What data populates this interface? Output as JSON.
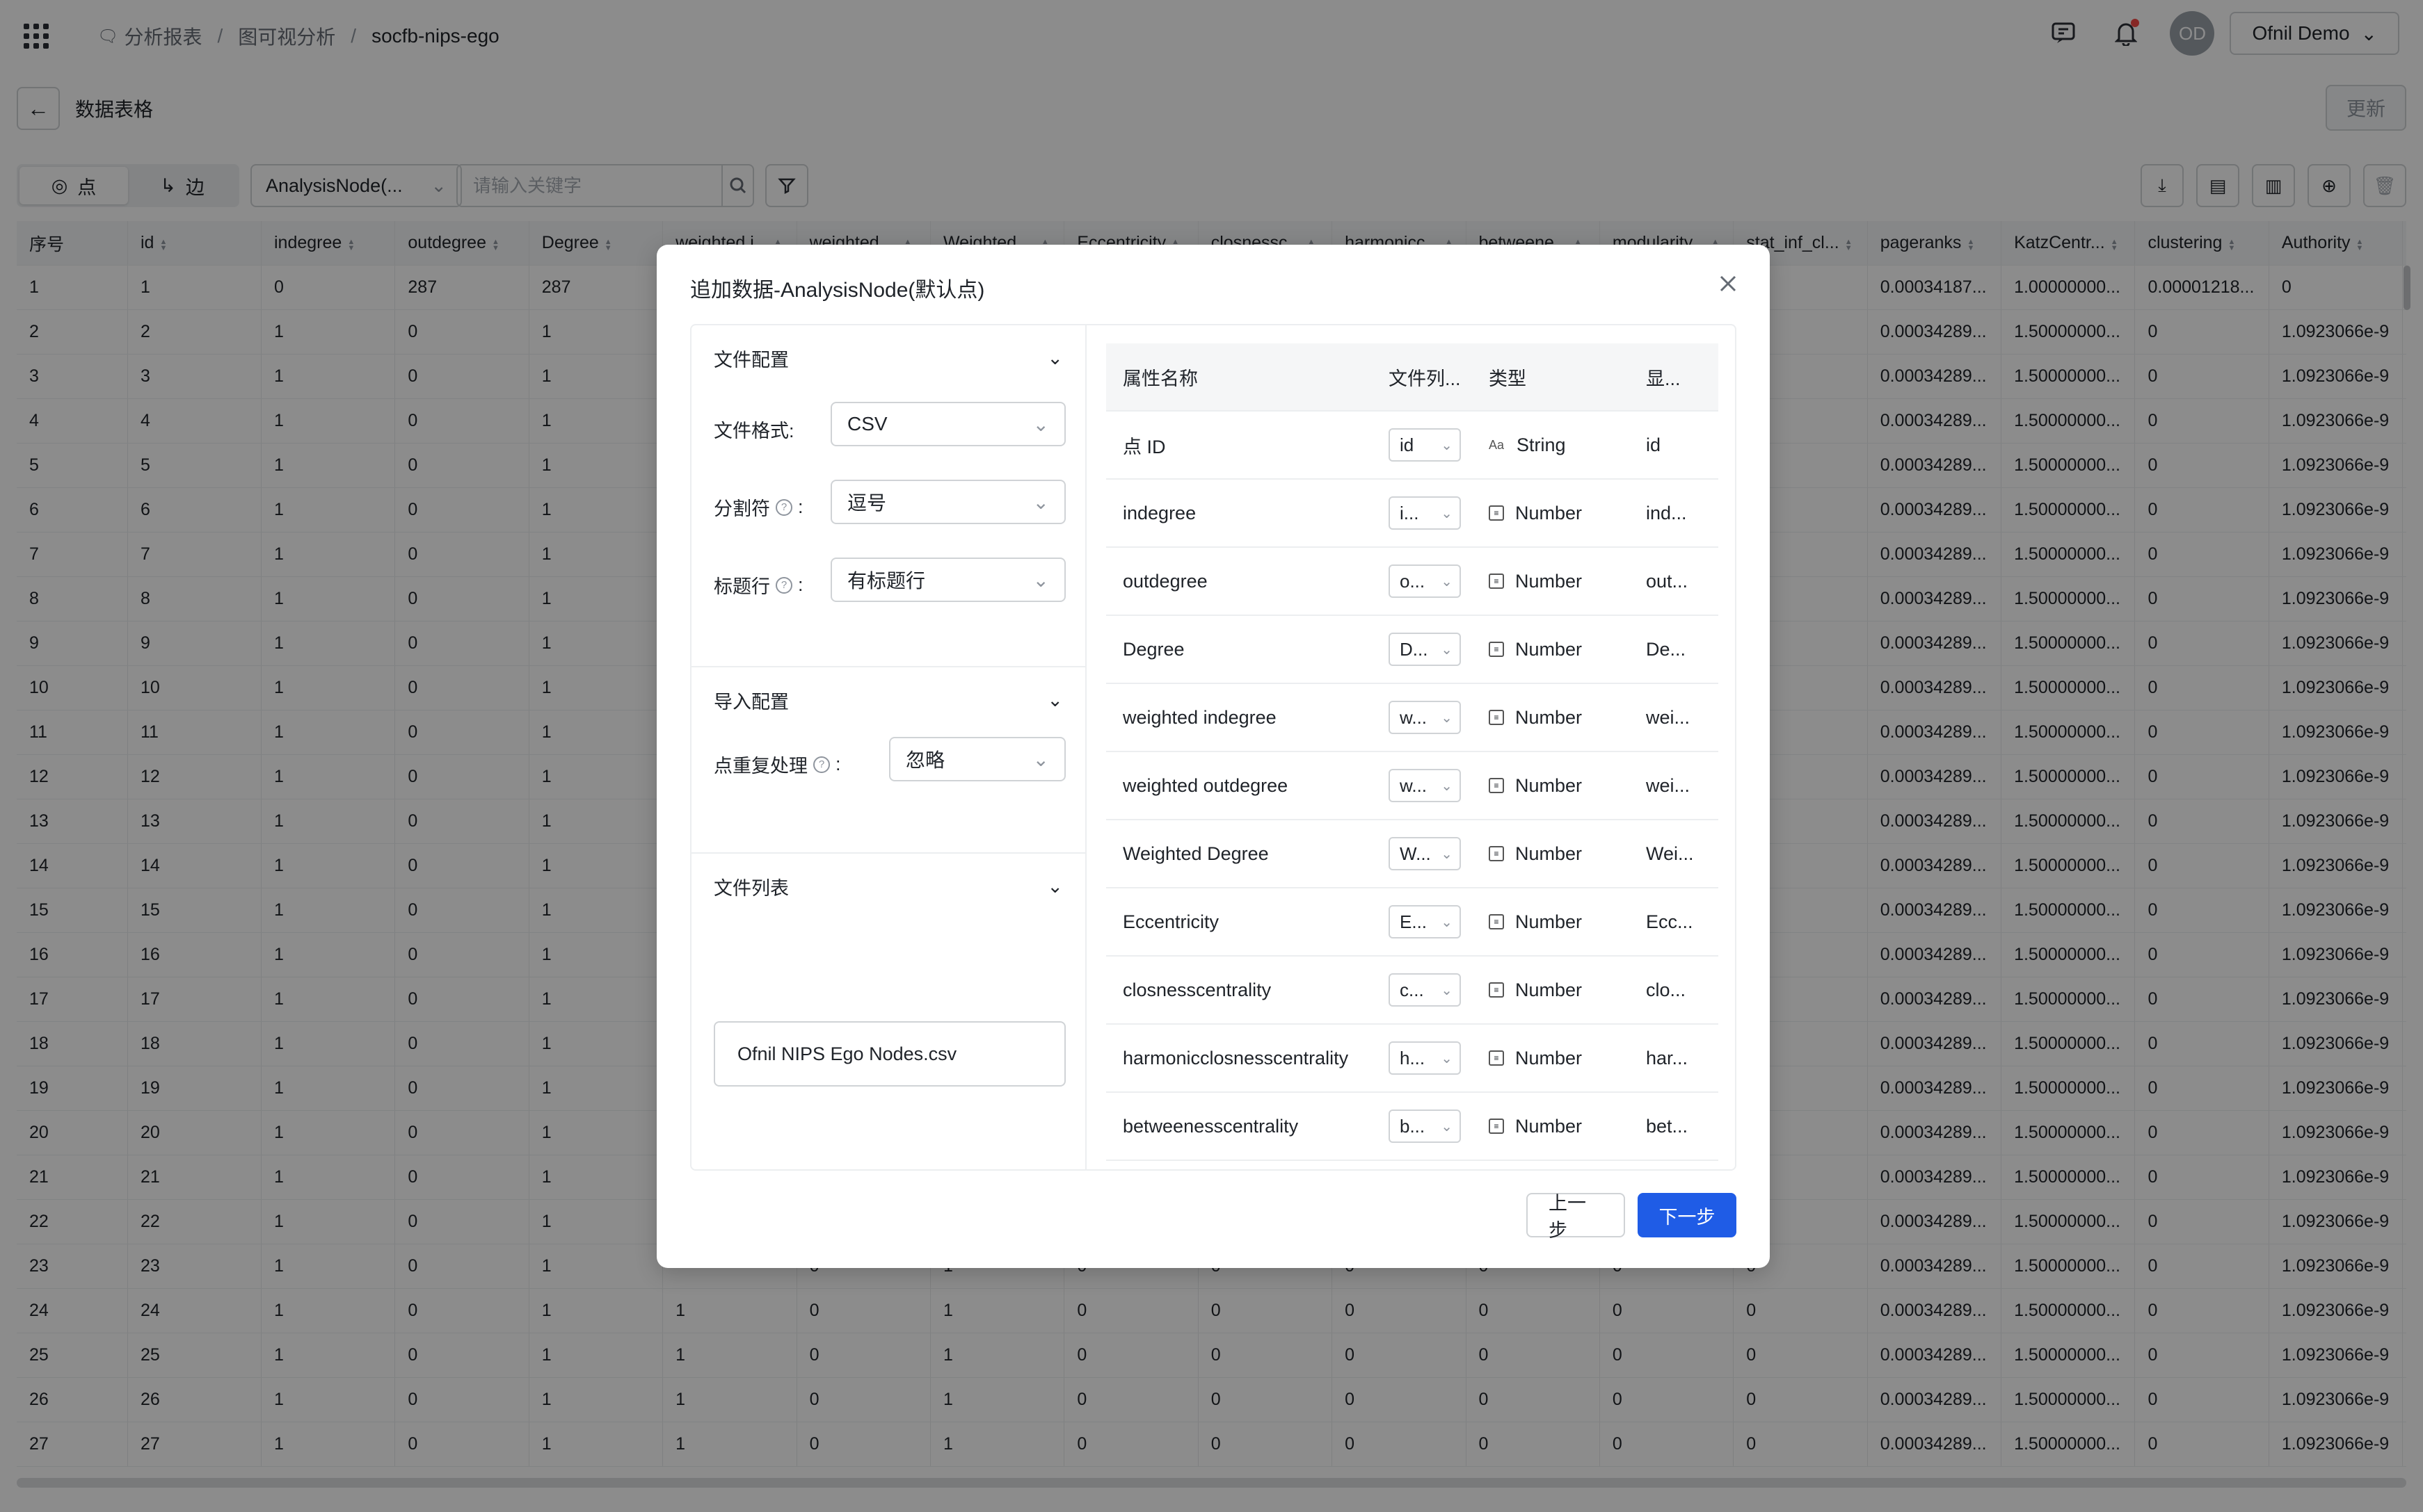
{
  "header": {
    "breadcrumb": [
      "分析报表",
      "图可视分析",
      "socfb-nips-ego"
    ],
    "user_initials": "OD",
    "user_name": "Ofnil Demo"
  },
  "subbar": {
    "title": "数据表格",
    "update_label": "更新"
  },
  "toolbar": {
    "seg_nodes": "点",
    "seg_edges": "边",
    "node_select": "AnalysisNode(...",
    "search_placeholder": "请输入关键字"
  },
  "table": {
    "columns": [
      "序号",
      "id",
      "indegree",
      "outdegree",
      "Degree",
      "weighted i...",
      "weighted ...",
      "Weighted ...",
      "Eccentricity",
      "closnessc...",
      "harmonicc...",
      "betweene...",
      "modularity...",
      "stat_inf_cl...",
      "pageranks",
      "KatzCentr...",
      "clustering",
      "Authority"
    ],
    "rows": [
      [
        "1",
        "1",
        "0",
        "287",
        "287",
        "",
        "",
        "",
        "",
        "",
        "",
        "",
        "",
        "",
        "0.00034187...",
        "1.00000000...",
        "0.00001218...",
        "0"
      ],
      [
        "2",
        "2",
        "1",
        "0",
        "1",
        "",
        "",
        "",
        "",
        "",
        "",
        "",
        "",
        "",
        "0.00034289...",
        "1.50000000...",
        "0",
        "1.0923066e-9"
      ],
      [
        "3",
        "3",
        "1",
        "0",
        "1",
        "",
        "",
        "",
        "",
        "",
        "",
        "",
        "",
        "",
        "0.00034289...",
        "1.50000000...",
        "0",
        "1.0923066e-9"
      ],
      [
        "4",
        "4",
        "1",
        "0",
        "1",
        "",
        "",
        "",
        "",
        "",
        "",
        "",
        "",
        "",
        "0.00034289...",
        "1.50000000...",
        "0",
        "1.0923066e-9"
      ],
      [
        "5",
        "5",
        "1",
        "0",
        "1",
        "",
        "",
        "",
        "",
        "",
        "",
        "",
        "",
        "",
        "0.00034289...",
        "1.50000000...",
        "0",
        "1.0923066e-9"
      ],
      [
        "6",
        "6",
        "1",
        "0",
        "1",
        "",
        "",
        "",
        "",
        "",
        "",
        "",
        "",
        "",
        "0.00034289...",
        "1.50000000...",
        "0",
        "1.0923066e-9"
      ],
      [
        "7",
        "7",
        "1",
        "0",
        "1",
        "",
        "",
        "",
        "",
        "",
        "",
        "",
        "",
        "",
        "0.00034289...",
        "1.50000000...",
        "0",
        "1.0923066e-9"
      ],
      [
        "8",
        "8",
        "1",
        "0",
        "1",
        "",
        "",
        "",
        "",
        "",
        "",
        "",
        "",
        "",
        "0.00034289...",
        "1.50000000...",
        "0",
        "1.0923066e-9"
      ],
      [
        "9",
        "9",
        "1",
        "0",
        "1",
        "",
        "",
        "",
        "",
        "",
        "",
        "",
        "",
        "",
        "0.00034289...",
        "1.50000000...",
        "0",
        "1.0923066e-9"
      ],
      [
        "10",
        "10",
        "1",
        "0",
        "1",
        "",
        "",
        "",
        "",
        "",
        "",
        "",
        "",
        "",
        "0.00034289...",
        "1.50000000...",
        "0",
        "1.0923066e-9"
      ],
      [
        "11",
        "11",
        "1",
        "0",
        "1",
        "",
        "",
        "",
        "",
        "",
        "",
        "",
        "",
        "",
        "0.00034289...",
        "1.50000000...",
        "0",
        "1.0923066e-9"
      ],
      [
        "12",
        "12",
        "1",
        "0",
        "1",
        "",
        "",
        "",
        "",
        "",
        "",
        "",
        "",
        "",
        "0.00034289...",
        "1.50000000...",
        "0",
        "1.0923066e-9"
      ],
      [
        "13",
        "13",
        "1",
        "0",
        "1",
        "",
        "",
        "",
        "",
        "",
        "",
        "",
        "",
        "",
        "0.00034289...",
        "1.50000000...",
        "0",
        "1.0923066e-9"
      ],
      [
        "14",
        "14",
        "1",
        "0",
        "1",
        "",
        "",
        "",
        "",
        "",
        "",
        "",
        "",
        "",
        "0.00034289...",
        "1.50000000...",
        "0",
        "1.0923066e-9"
      ],
      [
        "15",
        "15",
        "1",
        "0",
        "1",
        "",
        "",
        "",
        "",
        "",
        "",
        "",
        "",
        "",
        "0.00034289...",
        "1.50000000...",
        "0",
        "1.0923066e-9"
      ],
      [
        "16",
        "16",
        "1",
        "0",
        "1",
        "",
        "",
        "",
        "",
        "",
        "",
        "",
        "",
        "",
        "0.00034289...",
        "1.50000000...",
        "0",
        "1.0923066e-9"
      ],
      [
        "17",
        "17",
        "1",
        "0",
        "1",
        "",
        "",
        "",
        "",
        "",
        "",
        "",
        "",
        "",
        "0.00034289...",
        "1.50000000...",
        "0",
        "1.0923066e-9"
      ],
      [
        "18",
        "18",
        "1",
        "0",
        "1",
        "",
        "",
        "",
        "",
        "",
        "",
        "",
        "",
        "",
        "0.00034289...",
        "1.50000000...",
        "0",
        "1.0923066e-9"
      ],
      [
        "19",
        "19",
        "1",
        "0",
        "1",
        "",
        "",
        "",
        "",
        "",
        "",
        "",
        "",
        "",
        "0.00034289...",
        "1.50000000...",
        "0",
        "1.0923066e-9"
      ],
      [
        "20",
        "20",
        "1",
        "0",
        "1",
        "",
        "",
        "",
        "",
        "",
        "",
        "",
        "",
        "",
        "0.00034289...",
        "1.50000000...",
        "0",
        "1.0923066e-9"
      ],
      [
        "21",
        "21",
        "1",
        "0",
        "1",
        "",
        "",
        "",
        "",
        "",
        "",
        "",
        "",
        "",
        "0.00034289...",
        "1.50000000...",
        "0",
        "1.0923066e-9"
      ],
      [
        "22",
        "22",
        "1",
        "0",
        "1",
        "",
        "",
        "",
        "",
        "",
        "",
        "",
        "",
        "",
        "0.00034289...",
        "1.50000000...",
        "0",
        "1.0923066e-9"
      ],
      [
        "23",
        "23",
        "1",
        "0",
        "1",
        "",
        "0",
        "1",
        "0",
        "0",
        "0",
        "0",
        "0",
        "0",
        "0.00034289...",
        "1.50000000...",
        "0",
        "1.0923066e-9"
      ],
      [
        "24",
        "24",
        "1",
        "0",
        "1",
        "1",
        "0",
        "1",
        "0",
        "0",
        "0",
        "0",
        "0",
        "0",
        "0.00034289...",
        "1.50000000...",
        "0",
        "1.0923066e-9"
      ],
      [
        "25",
        "25",
        "1",
        "0",
        "1",
        "1",
        "0",
        "1",
        "0",
        "0",
        "0",
        "0",
        "0",
        "0",
        "0.00034289...",
        "1.50000000...",
        "0",
        "1.0923066e-9"
      ],
      [
        "26",
        "26",
        "1",
        "0",
        "1",
        "1",
        "0",
        "1",
        "0",
        "0",
        "0",
        "0",
        "0",
        "0",
        "0.00034289...",
        "1.50000000...",
        "0",
        "1.0923066e-9"
      ],
      [
        "27",
        "27",
        "1",
        "0",
        "1",
        "1",
        "0",
        "1",
        "0",
        "0",
        "0",
        "0",
        "0",
        "0",
        "0.00034289...",
        "1.50000000...",
        "0",
        "1.0923066e-9"
      ]
    ]
  },
  "modal": {
    "title": "追加数据-AnalysisNode(默认点)",
    "file_config": {
      "title": "文件配置",
      "format_label": "文件格式:",
      "format_value": "CSV",
      "delimiter_label": "分割符",
      "delimiter_value": "逗号",
      "header_label": "标题行",
      "header_value": "有标题行"
    },
    "import_config": {
      "title": "导入配置",
      "dup_label": "点重复处理",
      "dup_value": "忽略"
    },
    "file_list": {
      "title": "文件列表",
      "file_name": "Ofnil NIPS Ego Nodes.csv"
    },
    "prop_table": {
      "headers": [
        "属性名称",
        "文件列...",
        "类型",
        "显..."
      ],
      "rows": [
        {
          "name": "点 ID",
          "col": "id",
          "type": "String",
          "display": "id"
        },
        {
          "name": "indegree",
          "col": "i...",
          "type": "Number",
          "display": "ind..."
        },
        {
          "name": "outdegree",
          "col": "o...",
          "type": "Number",
          "display": "out..."
        },
        {
          "name": "Degree",
          "col": "D...",
          "type": "Number",
          "display": "De..."
        },
        {
          "name": "weighted indegree",
          "col": "w...",
          "type": "Number",
          "display": "wei..."
        },
        {
          "name": "weighted outdegree",
          "col": "w...",
          "type": "Number",
          "display": "wei..."
        },
        {
          "name": "Weighted Degree",
          "col": "W...",
          "type": "Number",
          "display": "Wei..."
        },
        {
          "name": "Eccentricity",
          "col": "E...",
          "type": "Number",
          "display": "Ecc..."
        },
        {
          "name": "closnesscentrality",
          "col": "c...",
          "type": "Number",
          "display": "clo..."
        },
        {
          "name": "harmonicclosnesscentrality",
          "col": "h...",
          "type": "Number",
          "display": "har..."
        },
        {
          "name": "betweenesscentrality",
          "col": "b...",
          "type": "Number",
          "display": "bet..."
        }
      ]
    },
    "prev_label": "上一步",
    "next_label": "下一步"
  }
}
